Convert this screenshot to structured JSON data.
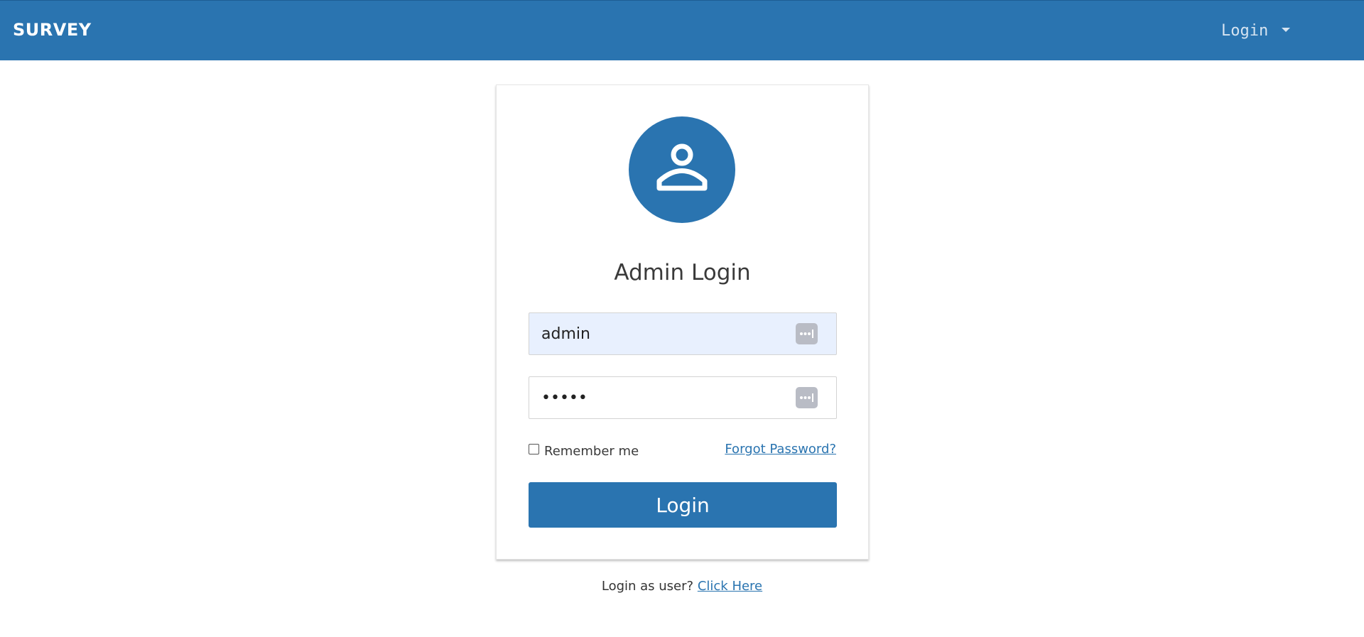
{
  "navbar": {
    "brand": "SURVEY",
    "login_menu_label": "Login"
  },
  "login_card": {
    "title": "Admin Login",
    "username_value": "admin",
    "password_value": "•••••",
    "remember_label": "Remember me",
    "forgot_label": "Forgot Password?",
    "submit_label": "Login"
  },
  "footer": {
    "prompt": "Login as user?",
    "link_label": "Click Here"
  },
  "colors": {
    "primary": "#2a74b0",
    "autofill_bg": "#e8f0fe",
    "key_icon": "#b9bcc5"
  },
  "icons": {
    "avatar": "user-icon",
    "password_manager": "password-manager-icon",
    "menu_caret": "caret-down-icon"
  }
}
